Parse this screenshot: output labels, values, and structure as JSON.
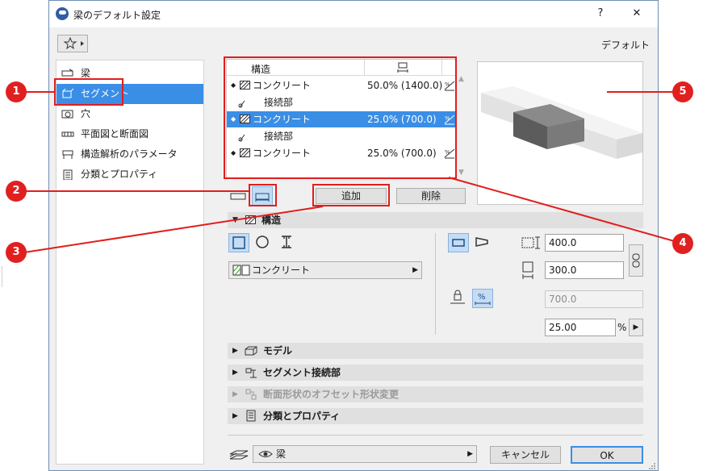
{
  "window": {
    "title": "梁のデフォルト設定",
    "help_label": "?",
    "close_label": "✕"
  },
  "header": {
    "default_label": "デフォルト"
  },
  "sidebar": {
    "items": [
      {
        "label": "梁"
      },
      {
        "label": "セグメント"
      },
      {
        "label": "穴"
      },
      {
        "label": "平面図と断面図"
      },
      {
        "label": "構造解析のパラメータ"
      },
      {
        "label": "分類とプロパティ"
      }
    ]
  },
  "segments": {
    "header": {
      "structure": "構造"
    },
    "rows": [
      {
        "name": "コンクリート",
        "value": "50.0% (1400.0)"
      },
      {
        "name": "接続部",
        "value": ""
      },
      {
        "name": "コンクリート",
        "value": "25.0% (700.0)"
      },
      {
        "name": "接続部",
        "value": ""
      },
      {
        "name": "コンクリート",
        "value": "25.0% (700.0)"
      }
    ],
    "add_label": "追加",
    "delete_label": "削除"
  },
  "structure_panel": {
    "title": "構造",
    "material": "コンクリート",
    "width": "400.0",
    "height": "300.0",
    "length_readonly": "700.0",
    "percent_value": "25.00",
    "percent_unit": "%"
  },
  "sections": [
    {
      "label": "モデル"
    },
    {
      "label": "セグメント接続部"
    },
    {
      "label": "断面形状のオフセット形状変更"
    },
    {
      "label": "分類とプロパティ"
    }
  ],
  "footer": {
    "layer": "梁",
    "cancel_label": "キャンセル",
    "ok_label": "OK"
  },
  "callouts": [
    "1",
    "2",
    "3",
    "4",
    "5"
  ],
  "colors": {
    "selection": "#3a8ee6",
    "callout": "#e02020",
    "toggle_on": "#c4dcf4"
  }
}
